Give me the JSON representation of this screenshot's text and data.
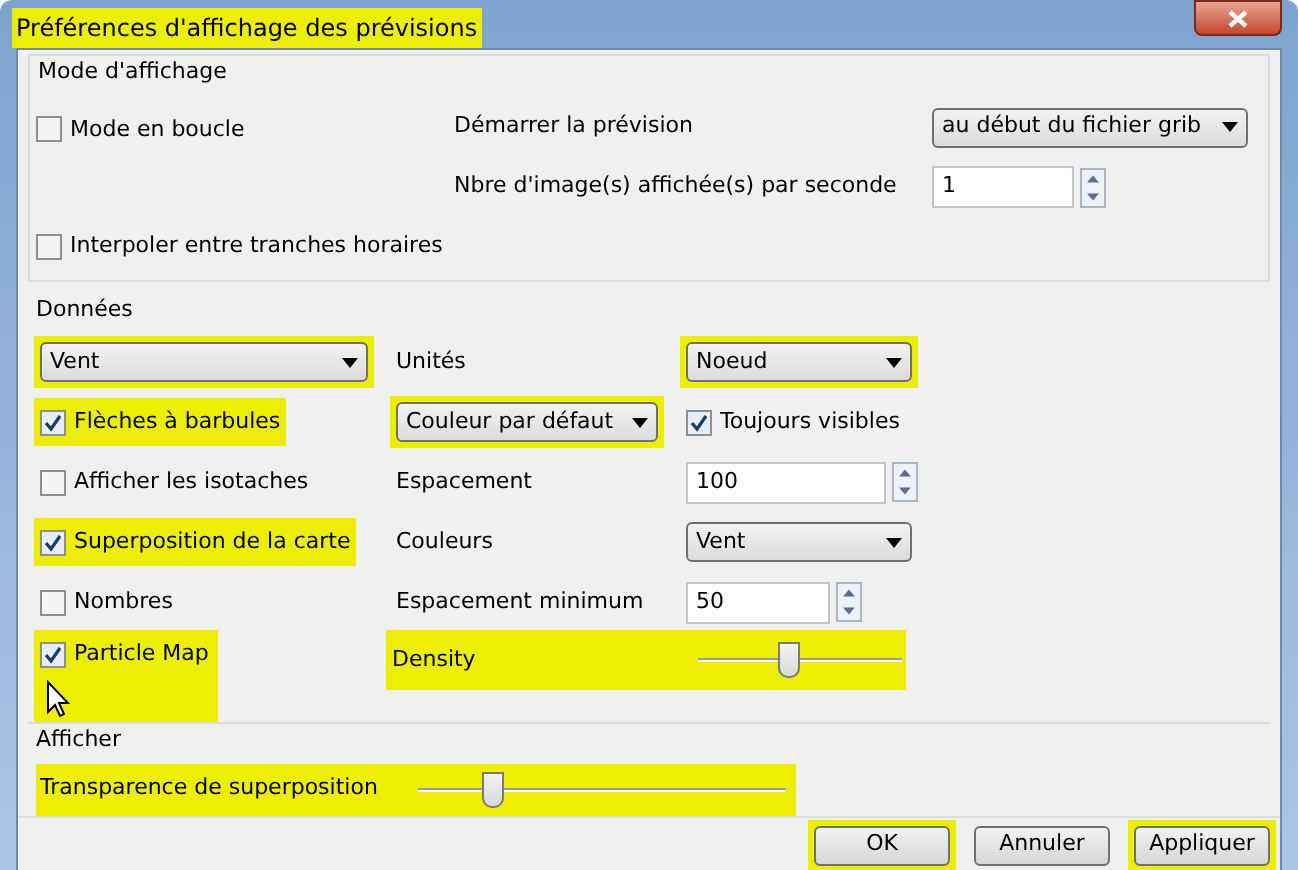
{
  "window": {
    "title": "Préférences d'affichage des prévisions",
    "highlighted": true
  },
  "mode": {
    "title": "Mode d'affichage",
    "loop": {
      "label": "Mode en boucle",
      "checked": false
    },
    "start": {
      "label": "Démarrer la prévision",
      "value": "au début du fichier grib"
    },
    "fps": {
      "label": "Nbre d'image(s) affichée(s) par seconde",
      "value": "1"
    },
    "interpolate": {
      "label": "Interpoler entre tranches horaires",
      "checked": false
    }
  },
  "data": {
    "title": "Données",
    "rows": [
      [
        {
          "kind": "select",
          "value": "Vent",
          "highlighted": true
        },
        {
          "kind": "label",
          "text": "Unités"
        },
        {
          "kind": "select",
          "value": "Noeud",
          "highlighted": true
        }
      ],
      [
        {
          "kind": "checkbox",
          "label": "Flèches à barbules",
          "checked": true,
          "highlighted": true
        },
        {
          "kind": "select",
          "value": "Couleur par défaut",
          "highlighted": true
        },
        {
          "kind": "checkbox",
          "label": "Toujours visibles",
          "checked": true,
          "highlighted": false
        }
      ],
      [
        {
          "kind": "checkbox",
          "label": "Afficher les isotaches",
          "checked": false,
          "highlighted": false
        },
        {
          "kind": "label",
          "text": "Espacement"
        },
        {
          "kind": "spin",
          "value": "100",
          "wide": true
        }
      ],
      [
        {
          "kind": "checkbox",
          "label": "Superposition de la carte",
          "checked": true,
          "highlighted": true
        },
        {
          "kind": "label",
          "text": "Couleurs"
        },
        {
          "kind": "select",
          "value": "Vent",
          "highlighted": false
        }
      ],
      [
        {
          "kind": "checkbox",
          "label": "Nombres",
          "checked": false,
          "highlighted": false
        },
        {
          "kind": "label",
          "text": "Espacement minimum"
        },
        {
          "kind": "spin",
          "value": "50",
          "wide": false
        }
      ]
    ],
    "particle": {
      "label": "Particle Map",
      "checked": true,
      "highlighted": true
    },
    "density": {
      "label": "Density",
      "level": 0.44,
      "highlighted": true
    }
  },
  "display": {
    "title": "Afficher",
    "transparency": {
      "label": "Transparence de superposition",
      "level": 0.2,
      "highlighted": true
    }
  },
  "buttons": [
    {
      "label": "OK",
      "highlighted": true
    },
    {
      "label": "Annuler",
      "highlighted": false
    },
    {
      "label": "Appliquer",
      "highlighted": true
    }
  ]
}
